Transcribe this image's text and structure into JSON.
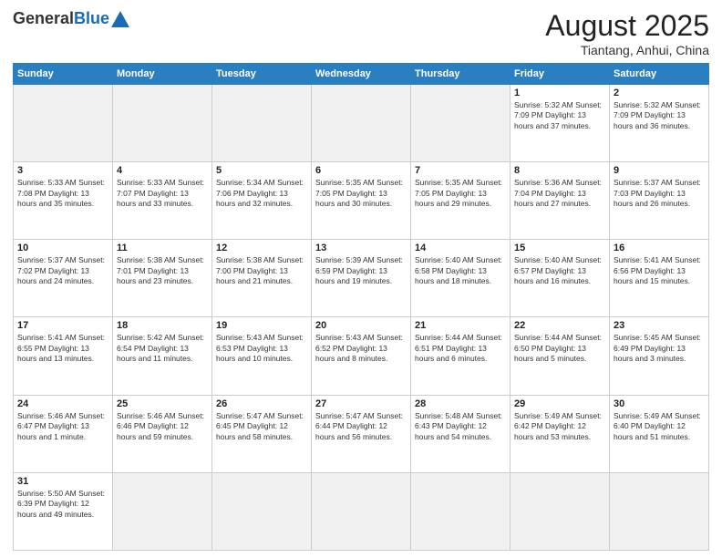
{
  "header": {
    "logo_general": "General",
    "logo_blue": "Blue",
    "month_title": "August 2025",
    "subtitle": "Tiantang, Anhui, China"
  },
  "days_of_week": [
    "Sunday",
    "Monday",
    "Tuesday",
    "Wednesday",
    "Thursday",
    "Friday",
    "Saturday"
  ],
  "weeks": [
    [
      {
        "day": "",
        "info": "",
        "empty": true
      },
      {
        "day": "",
        "info": "",
        "empty": true
      },
      {
        "day": "",
        "info": "",
        "empty": true
      },
      {
        "day": "",
        "info": "",
        "empty": true
      },
      {
        "day": "",
        "info": "",
        "empty": true
      },
      {
        "day": "1",
        "info": "Sunrise: 5:32 AM\nSunset: 7:09 PM\nDaylight: 13 hours\nand 37 minutes."
      },
      {
        "day": "2",
        "info": "Sunrise: 5:32 AM\nSunset: 7:09 PM\nDaylight: 13 hours\nand 36 minutes."
      }
    ],
    [
      {
        "day": "3",
        "info": "Sunrise: 5:33 AM\nSunset: 7:08 PM\nDaylight: 13 hours\nand 35 minutes."
      },
      {
        "day": "4",
        "info": "Sunrise: 5:33 AM\nSunset: 7:07 PM\nDaylight: 13 hours\nand 33 minutes."
      },
      {
        "day": "5",
        "info": "Sunrise: 5:34 AM\nSunset: 7:06 PM\nDaylight: 13 hours\nand 32 minutes."
      },
      {
        "day": "6",
        "info": "Sunrise: 5:35 AM\nSunset: 7:05 PM\nDaylight: 13 hours\nand 30 minutes."
      },
      {
        "day": "7",
        "info": "Sunrise: 5:35 AM\nSunset: 7:05 PM\nDaylight: 13 hours\nand 29 minutes."
      },
      {
        "day": "8",
        "info": "Sunrise: 5:36 AM\nSunset: 7:04 PM\nDaylight: 13 hours\nand 27 minutes."
      },
      {
        "day": "9",
        "info": "Sunrise: 5:37 AM\nSunset: 7:03 PM\nDaylight: 13 hours\nand 26 minutes."
      }
    ],
    [
      {
        "day": "10",
        "info": "Sunrise: 5:37 AM\nSunset: 7:02 PM\nDaylight: 13 hours\nand 24 minutes."
      },
      {
        "day": "11",
        "info": "Sunrise: 5:38 AM\nSunset: 7:01 PM\nDaylight: 13 hours\nand 23 minutes."
      },
      {
        "day": "12",
        "info": "Sunrise: 5:38 AM\nSunset: 7:00 PM\nDaylight: 13 hours\nand 21 minutes."
      },
      {
        "day": "13",
        "info": "Sunrise: 5:39 AM\nSunset: 6:59 PM\nDaylight: 13 hours\nand 19 minutes."
      },
      {
        "day": "14",
        "info": "Sunrise: 5:40 AM\nSunset: 6:58 PM\nDaylight: 13 hours\nand 18 minutes."
      },
      {
        "day": "15",
        "info": "Sunrise: 5:40 AM\nSunset: 6:57 PM\nDaylight: 13 hours\nand 16 minutes."
      },
      {
        "day": "16",
        "info": "Sunrise: 5:41 AM\nSunset: 6:56 PM\nDaylight: 13 hours\nand 15 minutes."
      }
    ],
    [
      {
        "day": "17",
        "info": "Sunrise: 5:41 AM\nSunset: 6:55 PM\nDaylight: 13 hours\nand 13 minutes."
      },
      {
        "day": "18",
        "info": "Sunrise: 5:42 AM\nSunset: 6:54 PM\nDaylight: 13 hours\nand 11 minutes."
      },
      {
        "day": "19",
        "info": "Sunrise: 5:43 AM\nSunset: 6:53 PM\nDaylight: 13 hours\nand 10 minutes."
      },
      {
        "day": "20",
        "info": "Sunrise: 5:43 AM\nSunset: 6:52 PM\nDaylight: 13 hours\nand 8 minutes."
      },
      {
        "day": "21",
        "info": "Sunrise: 5:44 AM\nSunset: 6:51 PM\nDaylight: 13 hours\nand 6 minutes."
      },
      {
        "day": "22",
        "info": "Sunrise: 5:44 AM\nSunset: 6:50 PM\nDaylight: 13 hours\nand 5 minutes."
      },
      {
        "day": "23",
        "info": "Sunrise: 5:45 AM\nSunset: 6:49 PM\nDaylight: 13 hours\nand 3 minutes."
      }
    ],
    [
      {
        "day": "24",
        "info": "Sunrise: 5:46 AM\nSunset: 6:47 PM\nDaylight: 13 hours\nand 1 minute."
      },
      {
        "day": "25",
        "info": "Sunrise: 5:46 AM\nSunset: 6:46 PM\nDaylight: 12 hours\nand 59 minutes."
      },
      {
        "day": "26",
        "info": "Sunrise: 5:47 AM\nSunset: 6:45 PM\nDaylight: 12 hours\nand 58 minutes."
      },
      {
        "day": "27",
        "info": "Sunrise: 5:47 AM\nSunset: 6:44 PM\nDaylight: 12 hours\nand 56 minutes."
      },
      {
        "day": "28",
        "info": "Sunrise: 5:48 AM\nSunset: 6:43 PM\nDaylight: 12 hours\nand 54 minutes."
      },
      {
        "day": "29",
        "info": "Sunrise: 5:49 AM\nSunset: 6:42 PM\nDaylight: 12 hours\nand 53 minutes."
      },
      {
        "day": "30",
        "info": "Sunrise: 5:49 AM\nSunset: 6:40 PM\nDaylight: 12 hours\nand 51 minutes."
      }
    ],
    [
      {
        "day": "31",
        "info": "Sunrise: 5:50 AM\nSunset: 6:39 PM\nDaylight: 12 hours\nand 49 minutes."
      },
      {
        "day": "",
        "info": "",
        "empty": true
      },
      {
        "day": "",
        "info": "",
        "empty": true
      },
      {
        "day": "",
        "info": "",
        "empty": true
      },
      {
        "day": "",
        "info": "",
        "empty": true
      },
      {
        "day": "",
        "info": "",
        "empty": true
      },
      {
        "day": "",
        "info": "",
        "empty": true
      }
    ]
  ]
}
